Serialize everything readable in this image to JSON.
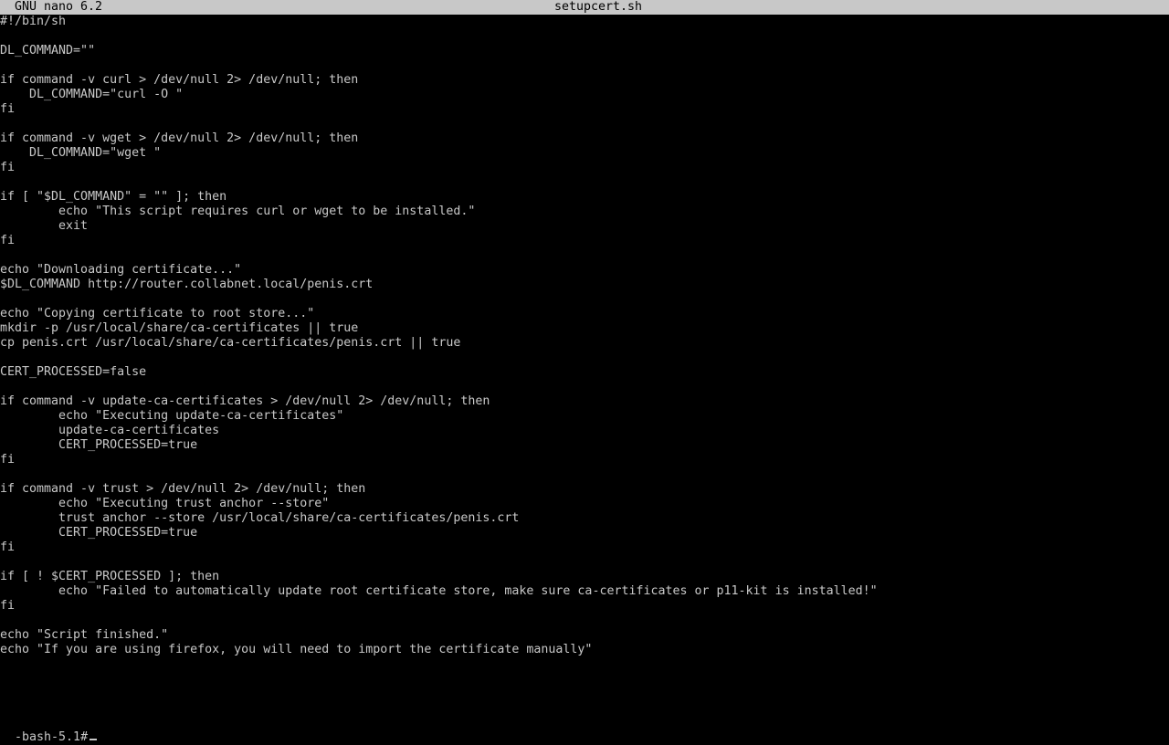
{
  "title_bar": {
    "app": "GNU nano 6.2",
    "filename": "setupcert.sh"
  },
  "colors": {
    "background": "#000000",
    "text": "#c8c8c8",
    "title_bar_bg": "#c8c8c8",
    "title_bar_fg": "#000000"
  },
  "lines": [
    "#!/bin/sh",
    "",
    "DL_COMMAND=\"\"",
    "",
    "if command -v curl > /dev/null 2> /dev/null; then",
    "    DL_COMMAND=\"curl -O \"",
    "fi",
    "",
    "if command -v wget > /dev/null 2> /dev/null; then",
    "    DL_COMMAND=\"wget \"",
    "fi",
    "",
    "if [ \"$DL_COMMAND\" = \"\" ]; then",
    "        echo \"This script requires curl or wget to be installed.\"",
    "        exit",
    "fi",
    "",
    "echo \"Downloading certificate...\"",
    "$DL_COMMAND http://router.collabnet.local/penis.crt",
    "",
    "echo \"Copying certificate to root store...\"",
    "mkdir -p /usr/local/share/ca-certificates || true",
    "cp penis.crt /usr/local/share/ca-certificates/penis.crt || true",
    "",
    "CERT_PROCESSED=false",
    "",
    "if command -v update-ca-certificates > /dev/null 2> /dev/null; then",
    "        echo \"Executing update-ca-certificates\"",
    "        update-ca-certificates",
    "        CERT_PROCESSED=true",
    "fi",
    "",
    "if command -v trust > /dev/null 2> /dev/null; then",
    "        echo \"Executing trust anchor --store\"",
    "        trust anchor --store /usr/local/share/ca-certificates/penis.crt",
    "        CERT_PROCESSED=true",
    "fi",
    "",
    "if [ ! $CERT_PROCESSED ]; then",
    "        echo \"Failed to automatically update root certificate store, make sure ca-certificates or p11-kit is installed!\"",
    "fi",
    "",
    "echo \"Script finished.\"",
    "echo \"If you are using firefox, you will need to import the certificate manually\""
  ],
  "shell": {
    "prompt": "-bash-5.1#"
  }
}
